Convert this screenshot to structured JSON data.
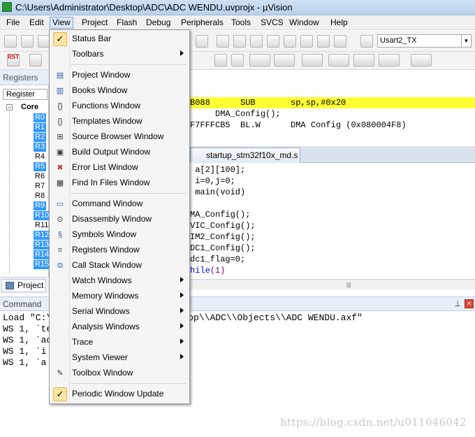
{
  "window": {
    "title": "C:\\Users\\Administrator\\Desktop\\ADC\\ADC WENDU.uvprojx - µVision"
  },
  "menubar": [
    {
      "label": "File"
    },
    {
      "label": "Edit"
    },
    {
      "label": "View"
    },
    {
      "label": "Project"
    },
    {
      "label": "Flash"
    },
    {
      "label": "Debug"
    },
    {
      "label": "Peripherals"
    },
    {
      "label": "Tools"
    },
    {
      "label": "SVCS"
    },
    {
      "label": "Window"
    },
    {
      "label": "Help"
    }
  ],
  "toolbar": {
    "target": "Usart2_TX",
    "rst_label": "RST"
  },
  "registers": {
    "header": "Registers",
    "column": "Register",
    "group": "Core",
    "items": [
      {
        "name": "R0",
        "highlighted": true
      },
      {
        "name": "R1",
        "highlighted": true
      },
      {
        "name": "R2",
        "highlighted": true
      },
      {
        "name": "R3",
        "highlighted": true
      },
      {
        "name": "R4",
        "highlighted": false
      },
      {
        "name": "R5",
        "highlighted": true
      },
      {
        "name": "R6",
        "highlighted": false
      },
      {
        "name": "R7",
        "highlighted": false
      },
      {
        "name": "R8",
        "highlighted": false
      },
      {
        "name": "R9",
        "highlighted": true
      },
      {
        "name": "R10",
        "highlighted": true
      },
      {
        "name": "R11",
        "highlighted": false
      },
      {
        "name": "R12",
        "highlighted": true
      },
      {
        "name": "R13",
        "highlighted": true
      },
      {
        "name": "R14",
        "highlighted": true
      },
      {
        "name": "R15",
        "highlighted": true
      }
    ],
    "project_tab": "Project"
  },
  "disassembly": [
    {
      "text": "B088      SUB       sp,sp,#0x20",
      "highlight": true
    },
    {
      "text": "     DMA_Config();",
      "highlight": false
    },
    {
      "text": "F7FFFCB5  BL.W      DMA Config (0x080004F8)",
      "highlight": false
    }
  ],
  "editor": {
    "tab": "startup_stm32f10x_md.s",
    "lines": [
      {
        "a": " a[2][100];",
        "b": "",
        "c": ""
      },
      {
        "a": " i=0,j=0;",
        "b": "",
        "c": ""
      },
      {
        "a": " main(void)",
        "b": "",
        "c": ""
      },
      {
        "a": "",
        "b": "",
        "c": ""
      },
      {
        "a": "MA_Config();",
        "b": "",
        "c": ""
      },
      {
        "a": "VIC_Config();",
        "b": "",
        "c": ""
      },
      {
        "a": "IM2_Config();",
        "b": "",
        "c": ""
      },
      {
        "a": "DC1_Config();",
        "b": "",
        "c": ""
      },
      {
        "a": "dc1_flag=0;",
        "b": "",
        "c": ""
      },
      {
        "a": "",
        "b": "hile",
        "c": "(1)"
      }
    ]
  },
  "command": {
    "header": "Command",
    "lines": [
      "Load \"C:\\Users\\Administrator\\Desktop\\\\ADC\\\\Objects\\\\ADC WENDU.axf\"",
      "WS 1, `te",
      "WS 1, `ad",
      "WS 1, `i",
      "WS 1, `a"
    ],
    "watermark": "https://blog.csdn.net/u011046042"
  },
  "view_menu": {
    "items": [
      {
        "label": "Status Bar",
        "icon": "checkmark-icon",
        "checked": true,
        "submenu": false
      },
      {
        "label": "Toolbars",
        "icon": "",
        "checked": false,
        "submenu": true
      },
      {
        "separator": true
      },
      {
        "label": "Project Window",
        "icon": "project-window-icon",
        "submenu": false
      },
      {
        "label": "Books Window",
        "icon": "books-window-icon",
        "submenu": false
      },
      {
        "label": "Functions Window",
        "icon": "functions-window-icon",
        "submenu": false
      },
      {
        "label": "Templates Window",
        "icon": "templates-window-icon",
        "submenu": false
      },
      {
        "label": "Source Browser Window",
        "icon": "source-browser-icon",
        "submenu": false
      },
      {
        "label": "Build Output Window",
        "icon": "build-output-icon",
        "submenu": false
      },
      {
        "label": "Error List Window",
        "icon": "error-list-icon",
        "submenu": false
      },
      {
        "label": "Find In Files Window",
        "icon": "find-in-files-icon",
        "submenu": false
      },
      {
        "separator": true
      },
      {
        "label": "Command Window",
        "icon": "command-window-icon",
        "submenu": false
      },
      {
        "label": "Disassembly Window",
        "icon": "disassembly-window-icon",
        "submenu": false
      },
      {
        "label": "Symbols Window",
        "icon": "symbols-window-icon",
        "submenu": false
      },
      {
        "label": "Registers Window",
        "icon": "registers-window-icon",
        "submenu": false
      },
      {
        "label": "Call Stack Window",
        "icon": "call-stack-icon",
        "submenu": false
      },
      {
        "label": "Watch Windows",
        "icon": "",
        "submenu": true
      },
      {
        "label": "Memory Windows",
        "icon": "",
        "submenu": true
      },
      {
        "label": "Serial Windows",
        "icon": "",
        "submenu": true
      },
      {
        "label": "Analysis Windows",
        "icon": "",
        "submenu": true
      },
      {
        "label": "Trace",
        "icon": "",
        "submenu": true
      },
      {
        "label": "System Viewer",
        "icon": "",
        "submenu": true
      },
      {
        "label": "Toolbox Window",
        "icon": "toolbox-window-icon",
        "submenu": false
      },
      {
        "separator": true
      },
      {
        "label": "Periodic Window Update",
        "icon": "checkmark-icon",
        "checked": true,
        "submenu": false
      }
    ]
  },
  "colors": {
    "selection_blue": "#3399ff",
    "pc_highlight": "#ffff33",
    "keyword": "#0000ff",
    "menu_check_bg": "#fce4a3"
  }
}
